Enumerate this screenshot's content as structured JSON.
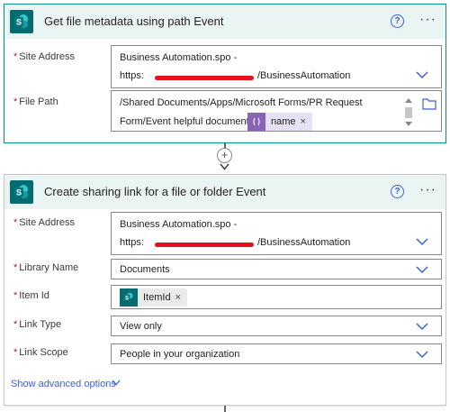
{
  "colors": {
    "accent": "#0a8f89",
    "header_bg": "#eaf4f3",
    "sharepoint": "#036c70",
    "link": "#3b61d6",
    "token_bg": "#e6e1f4",
    "redaction": "#e3121c",
    "required": "#a4262c"
  },
  "card1": {
    "title": "Get file metadata using path Event",
    "icon": "sharepoint-icon",
    "site_address": {
      "label": "Site Address",
      "line1": "Business Automation.spo -",
      "prefix": "https:",
      "suffix": "/BusinessAutomation"
    },
    "file_path": {
      "label": "File Path",
      "line1": "/Shared Documents/Apps/Microsoft Forms/PR Request",
      "line2": "Form/Event helpful documents/",
      "token": {
        "text": "name",
        "remove": "×",
        "icon": "expression-icon"
      }
    }
  },
  "connector": {
    "plus": "+"
  },
  "card2": {
    "title": "Create sharing link for a file or folder Event",
    "icon": "sharepoint-icon",
    "site_address": {
      "label": "Site Address",
      "line1": "Business Automation.spo -",
      "prefix": "https:",
      "suffix": "/BusinessAutomation"
    },
    "library_name": {
      "label": "Library Name",
      "value": "Documents"
    },
    "item_id": {
      "label": "Item Id",
      "token": {
        "text": "ItemId",
        "remove": "×",
        "icon": "sharepoint-icon"
      }
    },
    "link_type": {
      "label": "Link Type",
      "value": "View only"
    },
    "link_scope": {
      "label": "Link Scope",
      "value": "People in your organization"
    },
    "advanced": "Show advanced options"
  },
  "req_mark": "*",
  "help_glyph": "?",
  "more_glyph": "···"
}
